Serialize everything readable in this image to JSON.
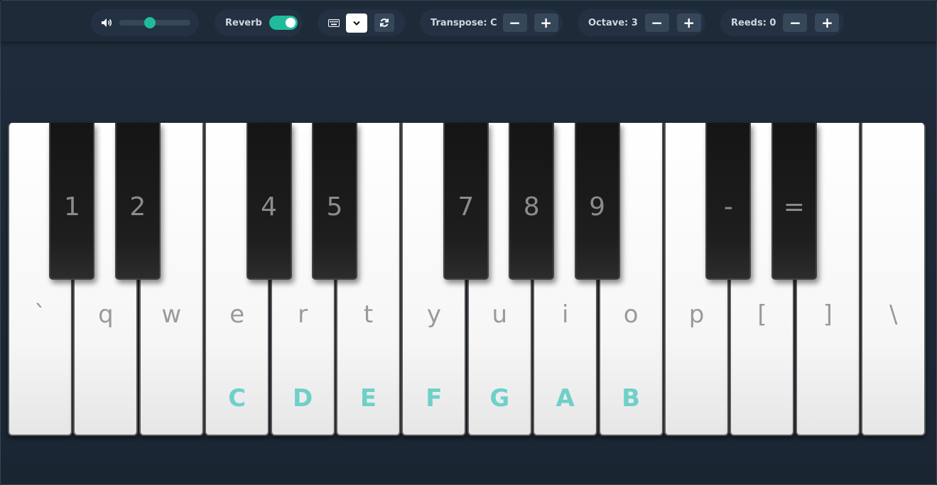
{
  "toolbar": {
    "reverb_label": "Reverb",
    "transpose_label": "Transpose: C",
    "octave_label": "Octave: 3",
    "reeds_label": "Reeds: 0",
    "minus": "−",
    "plus": "+",
    "volume_level": 0.45,
    "reverb_on": true,
    "icons": {
      "volume": "volume-icon",
      "keyboard": "keyboard-icon",
      "refresh": "refresh-icon",
      "select": "chevron-down-icon"
    },
    "colors": {
      "accent": "#1fbc9c",
      "button": "#36475a"
    }
  },
  "piano": {
    "white_keys": [
      {
        "key": "`",
        "note": ""
      },
      {
        "key": "q",
        "note": ""
      },
      {
        "key": "w",
        "note": ""
      },
      {
        "key": "e",
        "note": "C"
      },
      {
        "key": "r",
        "note": "D"
      },
      {
        "key": "t",
        "note": "E"
      },
      {
        "key": "y",
        "note": "F"
      },
      {
        "key": "u",
        "note": "G"
      },
      {
        "key": "i",
        "note": "A"
      },
      {
        "key": "o",
        "note": "B"
      },
      {
        "key": "p",
        "note": ""
      },
      {
        "key": "[",
        "note": ""
      },
      {
        "key": "]",
        "note": ""
      },
      {
        "key": "\\",
        "note": ""
      }
    ],
    "black_keys": [
      {
        "key": "1"
      },
      {
        "key": "2"
      },
      {
        "key": "4"
      },
      {
        "key": "5"
      },
      {
        "key": "7"
      },
      {
        "key": "8"
      },
      {
        "key": "9"
      },
      {
        "key": "-"
      },
      {
        "key": "="
      }
    ],
    "colors": {
      "note_label": "#6fd0c8"
    }
  }
}
